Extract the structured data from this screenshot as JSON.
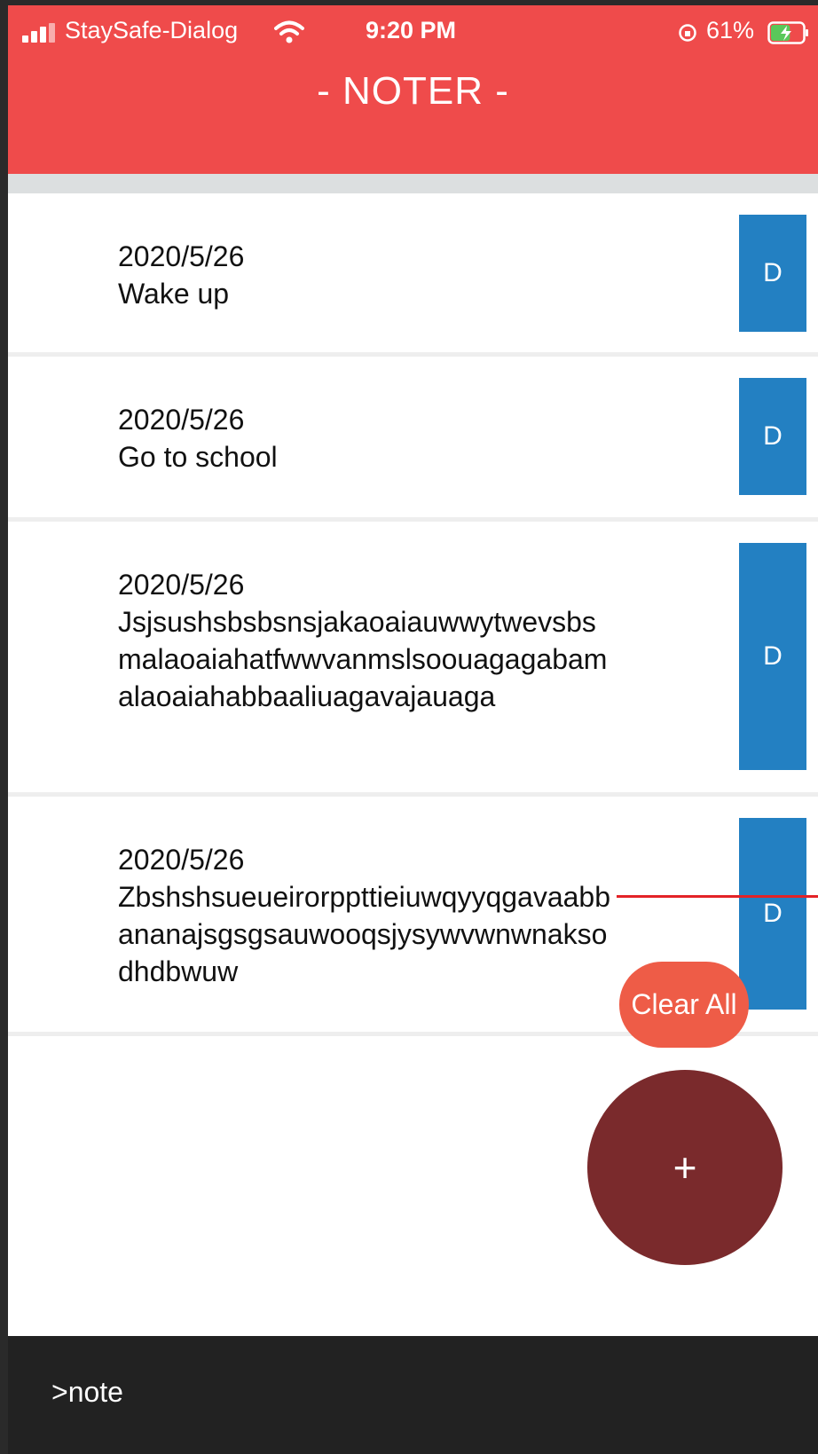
{
  "status_bar": {
    "carrier": "StaySafe-Dialog",
    "time": "9:20 PM",
    "battery": "61%",
    "battery_level": 0.61
  },
  "header": {
    "title": "- NOTER -",
    "color": "#ef4b4b"
  },
  "notes": [
    {
      "date": "2020/5/26",
      "text": "Wake up",
      "delete_label": "D"
    },
    {
      "date": "2020/5/26",
      "text": "Go to school",
      "delete_label": "D"
    },
    {
      "date": "2020/5/26",
      "text": "Jsjsushsbsbsnsjakaoaiauwwytwevsbsmalaoaiahatfwwvanmslsoouagagabamalaoaiahabbaaliuagavajauaga",
      "delete_label": "D"
    },
    {
      "date": "2020/5/26",
      "text": "Zbshshsueueirorppttieiuwqyyqgavaabbananajsgsgsauwooqsjysywvwnwnaksodhdbwuw",
      "delete_label": "D"
    }
  ],
  "clear_all_label": "Clear All",
  "add_label": "+",
  "footer": {
    "label": ">note"
  },
  "colors": {
    "delete_button": "#2380c2",
    "clear_all": "#ee5c47",
    "add_button": "#7a2a2c",
    "footer": "#222222"
  }
}
